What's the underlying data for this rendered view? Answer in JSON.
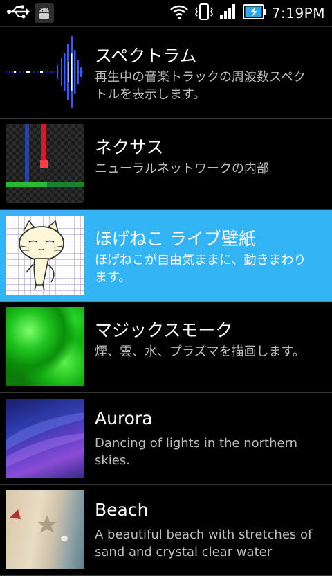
{
  "status_bar": {
    "time": "7:19PM",
    "icons": [
      "usb-icon",
      "android-debug-icon",
      "wifi-icon",
      "vibrate-icon",
      "signal-icon",
      "battery-charging-icon"
    ]
  },
  "wallpapers": [
    {
      "title": "スペクトラム",
      "description": "再生中の音楽トラックの周波数スペクトルを表示します。",
      "selected": false
    },
    {
      "title": "ネクサス",
      "description": "ニューラルネットワークの内部",
      "selected": false
    },
    {
      "title": "ほげねこ ライブ壁紙",
      "description": "ほげねこが自由気ままに、動きまわります。",
      "selected": true
    },
    {
      "title": "マジックスモーク",
      "description": "煙、雲、水、プラズマを描画します。",
      "selected": false
    },
    {
      "title": "Aurora",
      "description": "Dancing of lights in the northern skies.",
      "selected": false
    },
    {
      "title": "Beach",
      "description": "A beautiful beach with stretches of sand and crystal clear water",
      "selected": false
    }
  ],
  "colors": {
    "selected_row": "#33b5f5",
    "background": "#000000",
    "description_text": "#bdbdbd"
  }
}
